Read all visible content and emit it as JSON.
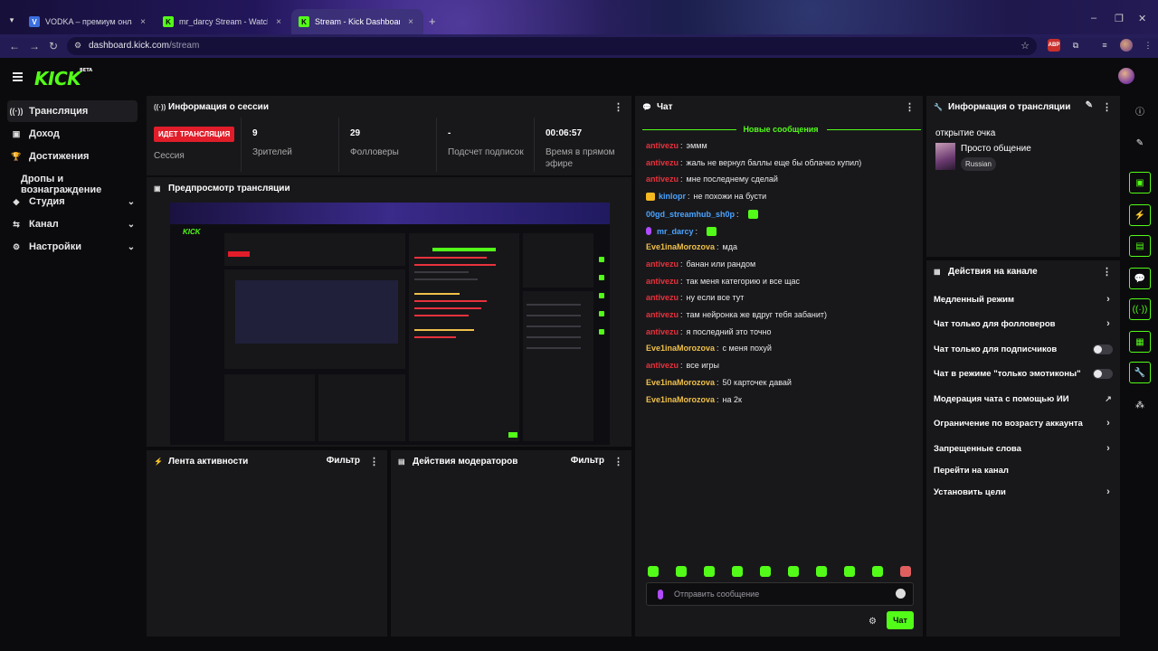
{
  "browser": {
    "tabs": [
      {
        "title": "VODKA – премиум онлайн-ка",
        "active": false
      },
      {
        "title": "mr_darcy Stream - Watch Live o",
        "active": false
      },
      {
        "title": "Stream - Kick Dashboard",
        "active": true
      }
    ],
    "new_tab": "+",
    "url_host": "dashboard.kick.com",
    "url_path": "/stream",
    "abp_label": "ABP"
  },
  "app": {
    "logo": "KICK",
    "logo_beta": "BETA"
  },
  "sidebar": {
    "items": [
      {
        "label": "Трансляция",
        "icon": "broadcast-icon",
        "active": true
      },
      {
        "label": "Доход",
        "icon": "wallet-icon"
      },
      {
        "label": "Достижения",
        "icon": "trophy-icon"
      },
      {
        "label": "Дропы и вознаграждение",
        "icon": ""
      },
      {
        "label": "Студия",
        "icon": "studio-icon",
        "expandable": true
      },
      {
        "label": "Канал",
        "icon": "channel-icon",
        "expandable": true
      },
      {
        "label": "Настройки",
        "icon": "settings-icon",
        "expandable": true
      }
    ]
  },
  "session": {
    "title": "Информация о сессии",
    "live_badge": "ИДЕТ ТРАНСЛЯЦИЯ",
    "live_label": "Сессия",
    "stats": [
      {
        "value": "9",
        "label": "Зрителей"
      },
      {
        "value": "29",
        "label": "Фолловеры"
      },
      {
        "value": "-",
        "label": "Подсчет подписок"
      },
      {
        "value": "00:06:57",
        "label": "Время в прямом эфире"
      }
    ]
  },
  "preview": {
    "title": "Предпросмотр трансляции"
  },
  "activity": {
    "title": "Лента активности",
    "filter": "Фильтр"
  },
  "mod_actions": {
    "title": "Действия модераторов",
    "filter": "Фильтр"
  },
  "chat": {
    "title": "Чат",
    "new_messages": "Новые сообщения",
    "messages": [
      {
        "user": "antivezu",
        "color": "#e8323c",
        "text": "эммм"
      },
      {
        "user": "antivezu",
        "color": "#e8323c",
        "text": "жаль не вернул баллы еще бы облачко купил)"
      },
      {
        "user": "antivezu",
        "color": "#e8323c",
        "text": "мне последнему сделай"
      },
      {
        "user": "kinlopr",
        "color": "#4aa3ff",
        "text": "не похожи на бусти",
        "badge": "crown"
      },
      {
        "user": "00gd_streamhub_sh0p",
        "color": "#4aa3ff",
        "text": "",
        "emote": true
      },
      {
        "user": "mr_darcy",
        "color": "#4aa3ff",
        "text": "",
        "badge": "mic",
        "emote": true
      },
      {
        "user": "Eve1inaMorozova",
        "color": "#f0c04a",
        "text": "мда"
      },
      {
        "user": "antivezu",
        "color": "#e8323c",
        "text": "банан или рандом"
      },
      {
        "user": "antivezu",
        "color": "#e8323c",
        "text": "так меня категорию и все щас"
      },
      {
        "user": "antivezu",
        "color": "#e8323c",
        "text": "ну если все тут"
      },
      {
        "user": "antivezu",
        "color": "#e8323c",
        "text": "там нейронка же вдруг тебя забанит)"
      },
      {
        "user": "antivezu",
        "color": "#e8323c",
        "text": "я последний это точно"
      },
      {
        "user": "Eve1inaMorozova",
        "color": "#f0c04a",
        "text": "с меня похуй"
      },
      {
        "user": "antivezu",
        "color": "#e8323c",
        "text": "все игры"
      },
      {
        "user": "Eve1inaMorozova",
        "color": "#f0c04a",
        "text": "50 карточек давай"
      },
      {
        "user": "Eve1inaMorozova",
        "color": "#f0c04a",
        "text": "на 2к"
      }
    ],
    "input_placeholder": "Отправить сообщение",
    "send_label": "Чат"
  },
  "stream_info": {
    "title": "Информация о трансляции",
    "stream_title": "открытие очка",
    "category": "Просто общение",
    "tag": "Russian"
  },
  "channel_actions": {
    "title": "Действия на канале",
    "items": [
      {
        "label": "Медленный режим",
        "control": "chevron"
      },
      {
        "label": "Чат только для фолловеров",
        "control": "chevron"
      },
      {
        "label": "Чат только для подписчиков",
        "control": "toggle",
        "on": false
      },
      {
        "label": "Чат в режиме \"только эмотиконы\"",
        "control": "toggle",
        "on": false
      },
      {
        "label": "Модерация чата с помощью ИИ",
        "control": "external"
      },
      {
        "label": "Ограничение по возрасту аккаунта",
        "control": "chevron"
      },
      {
        "label": "Запрещенные слова",
        "control": "chevron"
      },
      {
        "label": "Перейти на канал",
        "control": "none"
      },
      {
        "label": "Установить цели",
        "control": "chevron"
      }
    ]
  },
  "colors": {
    "accent": "#53fc18",
    "live": "#e11d2a",
    "panel": "#18181b"
  }
}
